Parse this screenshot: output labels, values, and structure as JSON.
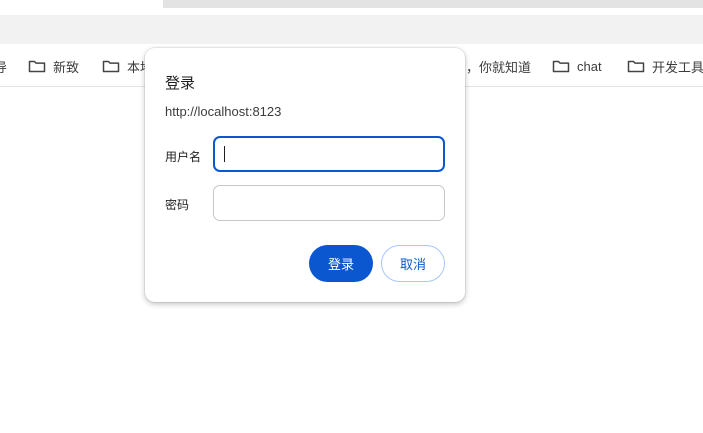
{
  "bookmarks": {
    "edge_fragment": "导",
    "items": [
      {
        "label": "新致"
      },
      {
        "label": "本地"
      },
      {
        "label": "，你就知道"
      },
      {
        "label": "chat"
      },
      {
        "label": "开发工具"
      }
    ]
  },
  "dialog": {
    "title": "登录",
    "origin": "http://localhost:8123",
    "username_label": "用户名",
    "username_value": "",
    "password_label": "密码",
    "password_value": "",
    "login_button": "登录",
    "cancel_button": "取消"
  },
  "colors": {
    "accent": "#0b57d0",
    "cancel_border": "#a8c7fa"
  },
  "icons": {
    "bookmark_folder": "folder-icon"
  }
}
